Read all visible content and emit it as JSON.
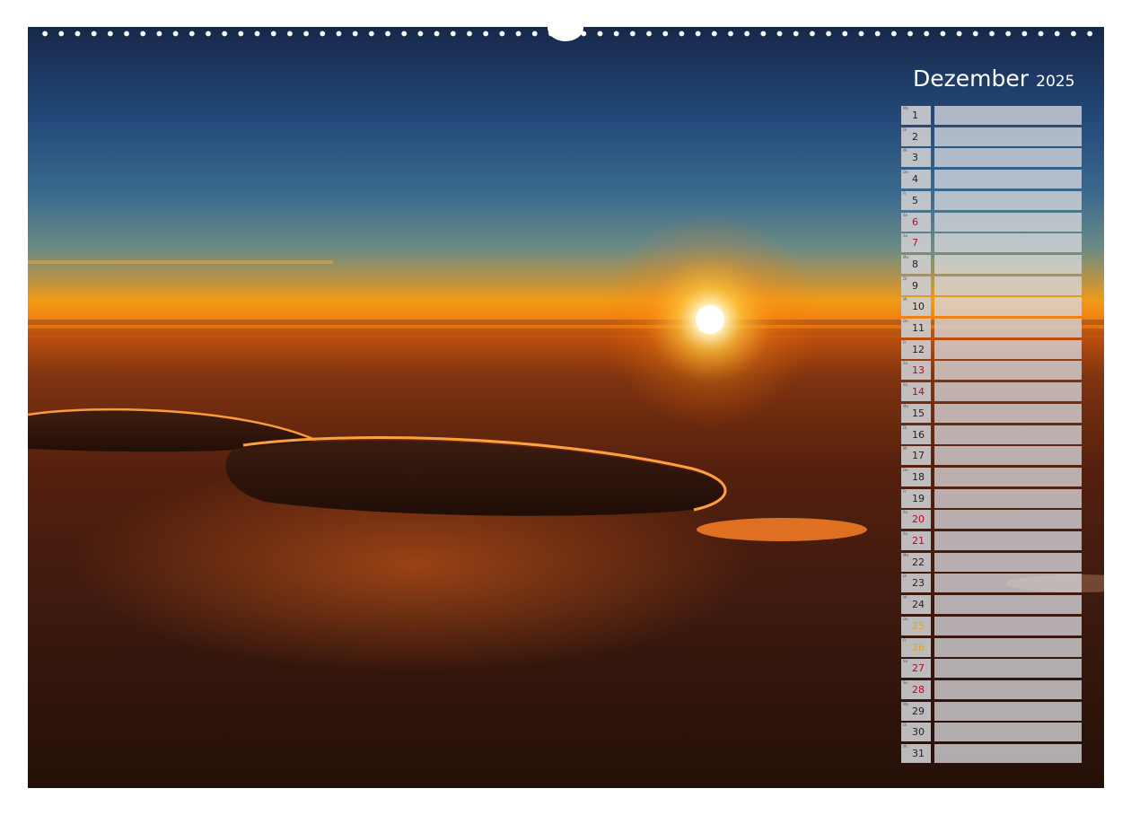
{
  "calendar": {
    "month": "Dezember",
    "year": "2025"
  },
  "days": [
    {
      "abbr": "Mo",
      "num": "1",
      "type": "weekday"
    },
    {
      "abbr": "Di",
      "num": "2",
      "type": "weekday"
    },
    {
      "abbr": "Mi",
      "num": "3",
      "type": "weekday"
    },
    {
      "abbr": "Do",
      "num": "4",
      "type": "weekday"
    },
    {
      "abbr": "Fr",
      "num": "5",
      "type": "weekday"
    },
    {
      "abbr": "Sa",
      "num": "6",
      "type": "sun"
    },
    {
      "abbr": "So",
      "num": "7",
      "type": "sun"
    },
    {
      "abbr": "Mo",
      "num": "8",
      "type": "weekday"
    },
    {
      "abbr": "Di",
      "num": "9",
      "type": "weekday"
    },
    {
      "abbr": "Mi",
      "num": "10",
      "type": "weekday"
    },
    {
      "abbr": "Do",
      "num": "11",
      "type": "weekday"
    },
    {
      "abbr": "Fr",
      "num": "12",
      "type": "weekday"
    },
    {
      "abbr": "Sa",
      "num": "13",
      "type": "sun"
    },
    {
      "abbr": "So",
      "num": "14",
      "type": "sun"
    },
    {
      "abbr": "Mo",
      "num": "15",
      "type": "weekday"
    },
    {
      "abbr": "Di",
      "num": "16",
      "type": "weekday"
    },
    {
      "abbr": "Mi",
      "num": "17",
      "type": "weekday"
    },
    {
      "abbr": "Do",
      "num": "18",
      "type": "weekday"
    },
    {
      "abbr": "Fr",
      "num": "19",
      "type": "weekday"
    },
    {
      "abbr": "Sa",
      "num": "20",
      "type": "sun"
    },
    {
      "abbr": "So",
      "num": "21",
      "type": "sun"
    },
    {
      "abbr": "Mo",
      "num": "22",
      "type": "weekday"
    },
    {
      "abbr": "Di",
      "num": "23",
      "type": "weekday"
    },
    {
      "abbr": "Mi",
      "num": "24",
      "type": "weekday"
    },
    {
      "abbr": "Do",
      "num": "25",
      "type": "hol"
    },
    {
      "abbr": "Fr",
      "num": "26",
      "type": "hol"
    },
    {
      "abbr": "Sa",
      "num": "27",
      "type": "sun"
    },
    {
      "abbr": "So",
      "num": "28",
      "type": "sun"
    },
    {
      "abbr": "Mo",
      "num": "29",
      "type": "weekday"
    },
    {
      "abbr": "Di",
      "num": "30",
      "type": "weekday"
    },
    {
      "abbr": "Mi",
      "num": "31",
      "type": "weekday"
    }
  ],
  "colors": {
    "sunday_text": "#b00d24",
    "holiday_text": "#d9a91e",
    "weekday_text": "#222222",
    "title_text": "#ffffff"
  }
}
